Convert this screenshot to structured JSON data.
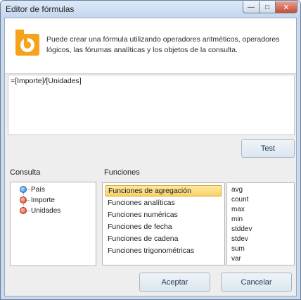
{
  "window": {
    "title": "Editor de fórmulas"
  },
  "header": {
    "description": "Puede crear una fórmula utilizando operadores aritméticos, operadores lógicos, las fórumas analíticas y los objetos de la consulta.",
    "logo_icon": "bitmap-b-logo",
    "logo_color": "#f5a31a"
  },
  "formula": {
    "value": "=[Importe]/[Unidades]"
  },
  "test_button": {
    "label": "Test"
  },
  "consulta": {
    "label": "Consulta",
    "items": [
      {
        "label": "País",
        "icon": "blue-dimension-dot"
      },
      {
        "label": "Importe",
        "icon": "red-measure-dot"
      },
      {
        "label": "Unidades",
        "icon": "red-measure-dot"
      }
    ]
  },
  "funciones": {
    "label": "Funciones",
    "categories": [
      "Funciones de agregación",
      "Funciones analíticas",
      "Funciones numéricas",
      "Funciones de fecha",
      "Funciones de cadena",
      "Funciones trigonométricas"
    ],
    "selected_category": "Funciones de agregación",
    "functions": [
      "avg",
      "count",
      "max",
      "min",
      "stddev",
      "stdev",
      "sum",
      "var"
    ]
  },
  "footer": {
    "ok_label": "Aceptar",
    "cancel_label": "Cancelar"
  },
  "colors": {
    "selection": "#f8d263",
    "accent_text": "#1e395b"
  }
}
